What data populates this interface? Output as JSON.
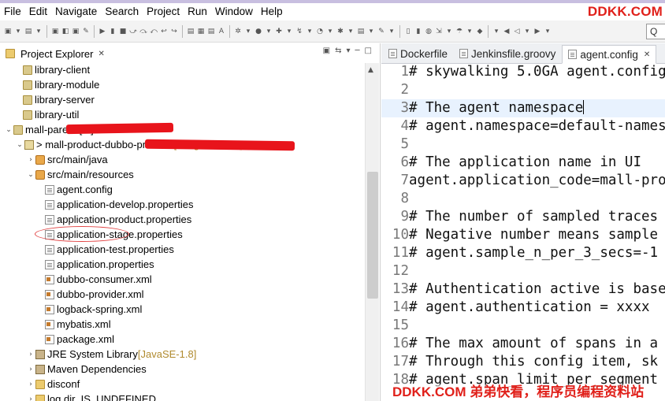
{
  "menu": [
    "File",
    "Edit",
    "Navigate",
    "Search",
    "Project",
    "Run",
    "Window",
    "Help"
  ],
  "brand": "DDKK.COM",
  "quick_access": "Q",
  "explorer": {
    "title": "Project Explorer",
    "close": "✕",
    "rows": [
      {
        "twisty": "",
        "icon": "proj",
        "label": "library-client",
        "annotation": ""
      },
      {
        "twisty": "",
        "icon": "proj",
        "label": "library-module",
        "annotation": ""
      },
      {
        "twisty": "",
        "icon": "proj",
        "label": "library-server",
        "annotation": ""
      },
      {
        "twisty": "",
        "icon": "proj",
        "label": "library-util",
        "annotation": ""
      },
      {
        "twisty": "⌄",
        "icon": "proj",
        "label": "mall-parent [...]",
        "annotation": ""
      },
      {
        "twisty": "⌄",
        "icon": "proj2",
        "label": "> mall-product-dubbo-provider",
        "annotation": " [... agent-0214]"
      },
      {
        "twisty": "›",
        "icon": "pkg",
        "label": "src/main/java",
        "annotation": ""
      },
      {
        "twisty": "⌄",
        "icon": "pkg",
        "label": "src/main/resources",
        "annotation": ""
      },
      {
        "twisty": "",
        "icon": "file",
        "label": "agent.config",
        "annotation": ""
      },
      {
        "twisty": "",
        "icon": "file",
        "label": "application-develop.properties",
        "annotation": ""
      },
      {
        "twisty": "",
        "icon": "file",
        "label": "application-product.properties",
        "annotation": ""
      },
      {
        "twisty": "",
        "icon": "file",
        "label": "application-stage.properties",
        "annotation": ""
      },
      {
        "twisty": "",
        "icon": "file",
        "label": "application-test.properties",
        "annotation": ""
      },
      {
        "twisty": "",
        "icon": "file",
        "label": "application.properties",
        "annotation": ""
      },
      {
        "twisty": "",
        "icon": "xml",
        "label": "dubbo-consumer.xml",
        "annotation": ""
      },
      {
        "twisty": "",
        "icon": "xml",
        "label": "dubbo-provider.xml",
        "annotation": ""
      },
      {
        "twisty": "",
        "icon": "xml",
        "label": "logback-spring.xml",
        "annotation": ""
      },
      {
        "twisty": "",
        "icon": "xml",
        "label": "mybatis.xml",
        "annotation": ""
      },
      {
        "twisty": "",
        "icon": "xml",
        "label": "package.xml",
        "annotation": ""
      },
      {
        "twisty": "›",
        "icon": "lib",
        "label": "JRE System Library",
        "annotation": " [JavaSE-1.8]"
      },
      {
        "twisty": "›",
        "icon": "lib",
        "label": "Maven Dependencies",
        "annotation": ""
      },
      {
        "twisty": "›",
        "icon": "folder",
        "label": "disconf",
        "annotation": ""
      },
      {
        "twisty": "›",
        "icon": "folder",
        "label": "log.dir_IS_UNDEFINED",
        "annotation": ""
      }
    ]
  },
  "editor": {
    "tabs": [
      {
        "label": "Dockerfile",
        "active": false,
        "close": ""
      },
      {
        "label": "Jenkinsfile.groovy",
        "active": false,
        "close": ""
      },
      {
        "label": "agent.config",
        "active": true,
        "close": "✕"
      }
    ],
    "lines": [
      {
        "n": "1",
        "text": "# skywalking 5.0GA agent.config"
      },
      {
        "n": "2",
        "text": ""
      },
      {
        "n": "3",
        "text": "# The agent namespace"
      },
      {
        "n": "4",
        "text": "# agent.namespace=default-namespace"
      },
      {
        "n": "5",
        "text": ""
      },
      {
        "n": "6",
        "text": "# The application name in UI"
      },
      {
        "n": "7",
        "text": "agent.application_code=mall-product"
      },
      {
        "n": "8",
        "text": ""
      },
      {
        "n": "9",
        "text": "# The number of sampled traces"
      },
      {
        "n": "10",
        "text": "# Negative number means sample all"
      },
      {
        "n": "11",
        "text": "# agent.sample_n_per_3_secs=-1"
      },
      {
        "n": "12",
        "text": ""
      },
      {
        "n": "13",
        "text": "# Authentication active is based"
      },
      {
        "n": "14",
        "text": "# agent.authentication = xxxx"
      },
      {
        "n": "15",
        "text": ""
      },
      {
        "n": "16",
        "text": "# The max amount of spans in a"
      },
      {
        "n": "17",
        "text": "# Through this config item, sk"
      },
      {
        "n": "18",
        "text": "# agent.span_limit_per_segment"
      }
    ]
  },
  "watermark": "DDKK.COM 弟弟快看，程序员编程资料站"
}
